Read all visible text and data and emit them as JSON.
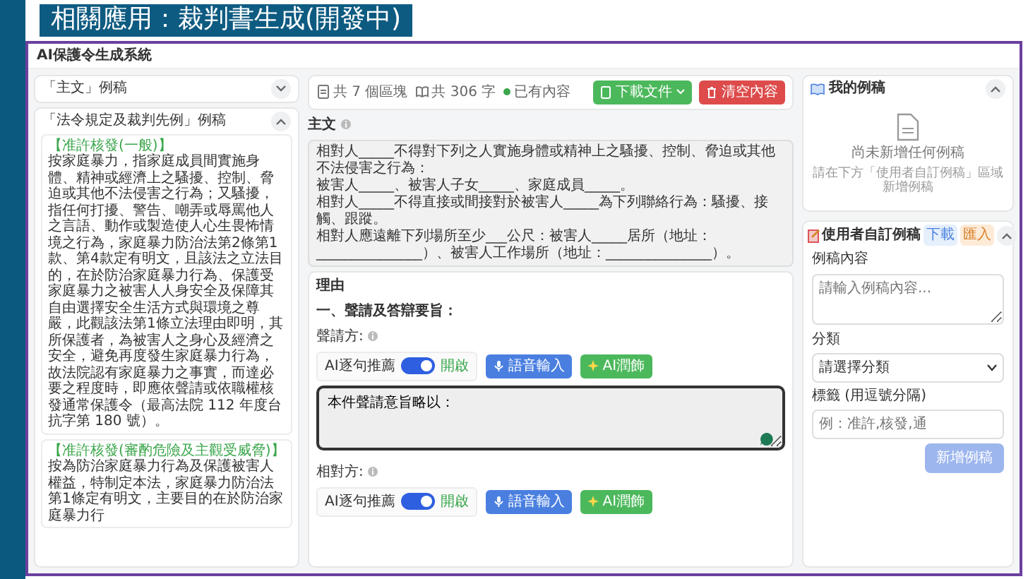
{
  "slide_title": "相關應用：裁判書生成(開發中)",
  "app_title": "AI保護令生成系統",
  "left_panel": {
    "sections": [
      {
        "title": "「主文」例稿",
        "expanded": false
      },
      {
        "title": "「法令規定及裁判先例」例稿",
        "expanded": true,
        "examples": [
          {
            "heading": "【准許核發(一般)】",
            "text": "按家庭暴力，指家庭成員間實施身體、精神或經濟上之騷擾、控制、脅迫或其他不法侵害之行為；又騷擾，指任何打擾、警告、嘲弄或辱罵他人之言語、動作或製造使人心生畏怖情境之行為，家庭暴力防治法第2條第1款、第4款定有明文，且該法之立法目的，在於防治家庭暴力行為、保護受家庭暴力之被害人人身安全及保障其自由選擇安全生活方式與環境之尊嚴，此觀該法第1條立法理由即明，其所保護者，為被害人之身心及經濟之安全，避免再度發生家庭暴力行為，故法院認有家庭暴力之事實，而達必要之程度時，即應依聲請或依職權核發通常保護令（最高法院 112 年度台抗字第 180 號）。"
          },
          {
            "heading": "【准許核發(審酌危險及主觀受威脅)】",
            "text": "按為防治家庭暴力行為及保護被害人權益，特制定本法，家庭暴力防治法第1條定有明文，主要目的在於防治家庭暴力行"
          }
        ]
      }
    ]
  },
  "toolbar": {
    "stats": [
      {
        "kind": "blocks",
        "text": "共 7 個區塊"
      },
      {
        "kind": "words",
        "text": "共 306 字"
      },
      {
        "kind": "status",
        "text": "已有內容"
      }
    ],
    "buttons": [
      {
        "kind": "download",
        "label": "下載文件"
      },
      {
        "kind": "clear",
        "label": "清空內容"
      }
    ]
  },
  "main_text": {
    "label": "主文",
    "lines": [
      "相對人_____不得對下列之人實施身體或精神上之騷擾、控制、脅迫或其他不法侵害之行為：",
      "被害人_____、被害人子女_____、家庭成員_____。",
      "相對人_____不得直接或間接對於被害人_____為下列聯絡行為：騷擾、接觸、跟蹤。",
      "相對人應遠離下列場所至少___公尺：被害人_____居所（地址：_______________）、被害人工作場所（地址：_______________）。"
    ]
  },
  "reason": {
    "title": "理由",
    "section": "一、聲請及答辯要旨：",
    "parties": [
      {
        "label": "聲請方:",
        "toggle_label": "AI逐句推薦",
        "on": true,
        "state_text": "開啟",
        "buttons": [
          {
            "kind": "voice",
            "label": "語音輸入"
          },
          {
            "kind": "polish",
            "label": "AI潤飾"
          }
        ],
        "value": "本件聲請意旨略以："
      },
      {
        "label": "相對方:",
        "toggle_label": "AI逐句推薦",
        "on": true,
        "state_text": "開啟",
        "buttons": [
          {
            "kind": "voice",
            "label": "語音輸入"
          },
          {
            "kind": "polish",
            "label": "AI潤飾"
          }
        ]
      }
    ]
  },
  "my_examples": {
    "title": "我的例稿",
    "expanded": true,
    "empty_title": "尚未新增任何例稿",
    "empty_hint": "請在下方「使用者自訂例稿」區域新增例稿"
  },
  "custom": {
    "title": "使用者自訂例稿",
    "expanded": true,
    "badges": [
      {
        "kind": "download",
        "label": "下載"
      },
      {
        "kind": "import",
        "label": "匯入"
      }
    ],
    "content_label": "例稿內容",
    "content_placeholder": "請輸入例稿內容...",
    "category_label": "分類",
    "category_value": "請選擇分類",
    "tags_label": "標籤 (用逗號分隔)",
    "tags_placeholder": "例：准許,核發,通",
    "submit": "新增例稿"
  }
}
